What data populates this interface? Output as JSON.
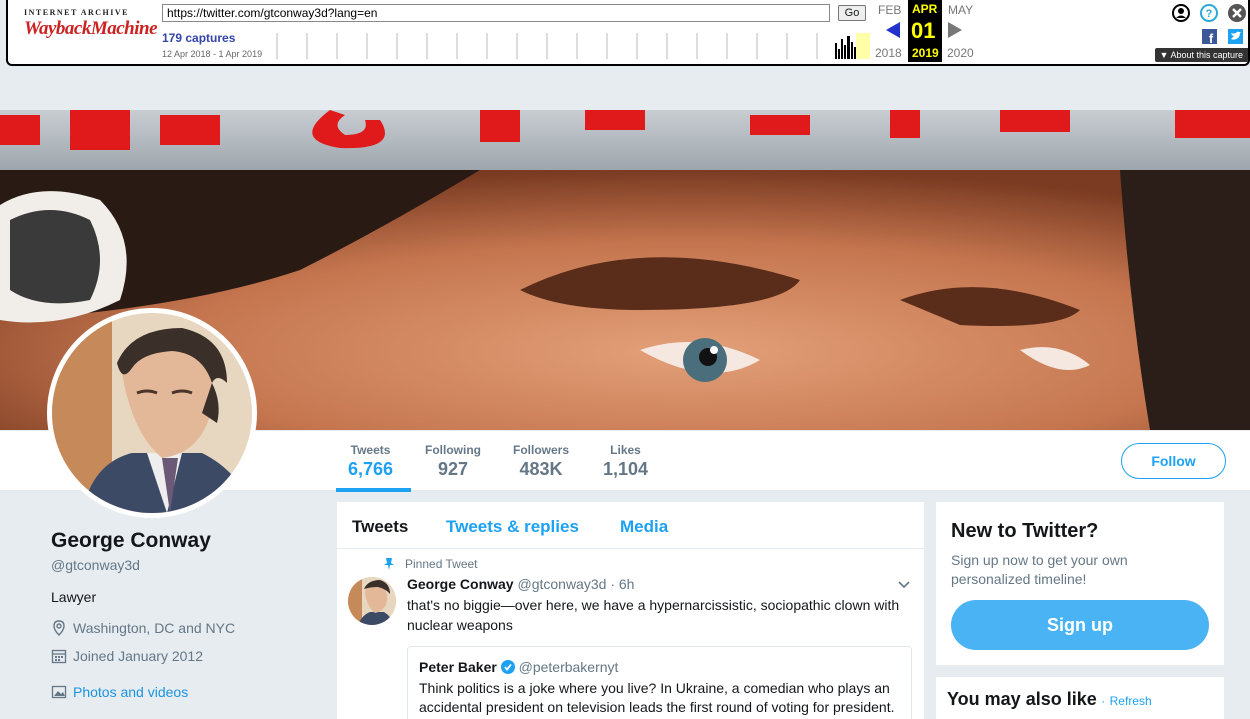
{
  "wayback": {
    "logo_small": "INTERNET ARCHIVE",
    "logo_big": "WaybackMachine",
    "url": "https://twitter.com/gtconway3d?lang=en",
    "go_label": "Go",
    "captures": "179 captures",
    "range": "12 Apr 2018 - 1 Apr 2019",
    "prev_month": "FEB",
    "cur_month": "APR",
    "next_month": "MAY",
    "day": "01",
    "prev_year": "2018",
    "cur_year": "2019",
    "next_year": "2020",
    "about": "▼ About this capture"
  },
  "profile": {
    "stats": [
      {
        "label": "Tweets",
        "value": "6,766"
      },
      {
        "label": "Following",
        "value": "927"
      },
      {
        "label": "Followers",
        "value": "483K"
      },
      {
        "label": "Likes",
        "value": "1,104"
      }
    ],
    "follow_label": "Follow",
    "name": "George Conway",
    "handle": "@gtconway3d",
    "bio": "Lawyer",
    "location": "Washington, DC and NYC",
    "joined": "Joined January 2012",
    "photos": "Photos and videos"
  },
  "timeline": {
    "tabs": [
      "Tweets",
      "Tweets & replies",
      "Media"
    ],
    "pinned": "Pinned Tweet",
    "tweet": {
      "name": "George Conway",
      "handle": "@gtconway3d",
      "time": "· 6h",
      "text": "that's no biggie—over here, we have a hypernarcissistic, sociopathic clown with nuclear weapons"
    },
    "quote": {
      "name": "Peter Baker",
      "handle": "@peterbakernyt",
      "text": "Think politics is a joke where you live? In Ukraine, a comedian who plays an accidental president on television leads the first round of voting for president."
    }
  },
  "sidebar": {
    "new_title": "New to Twitter?",
    "new_text": "Sign up now to get your own personalized timeline!",
    "signup": "Sign up",
    "also_title": "You may also like",
    "refresh": "Refresh"
  }
}
